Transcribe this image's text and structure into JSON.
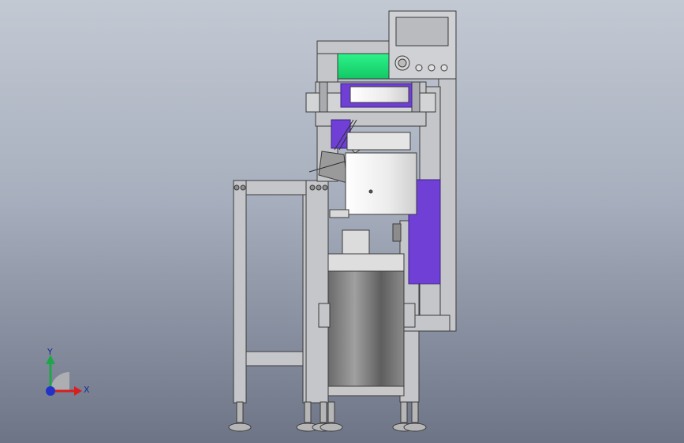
{
  "viewport": {
    "background_top": "#c3c9d3",
    "background_bottom": "#6c7486"
  },
  "model": {
    "frame_color": "#c4c6c9",
    "outline_color": "#3b3b3b",
    "green_roll_color": "#19e87a",
    "purple_film_color": "#6f3fd6",
    "drum_color": "#7a7a7a"
  },
  "controller": {
    "knob_count": 4
  },
  "triad": {
    "x_label": "X",
    "y_label": "Y",
    "x_color": "#d91e1e",
    "y_color": "#1fa64a",
    "z_color": "#2431c8"
  }
}
